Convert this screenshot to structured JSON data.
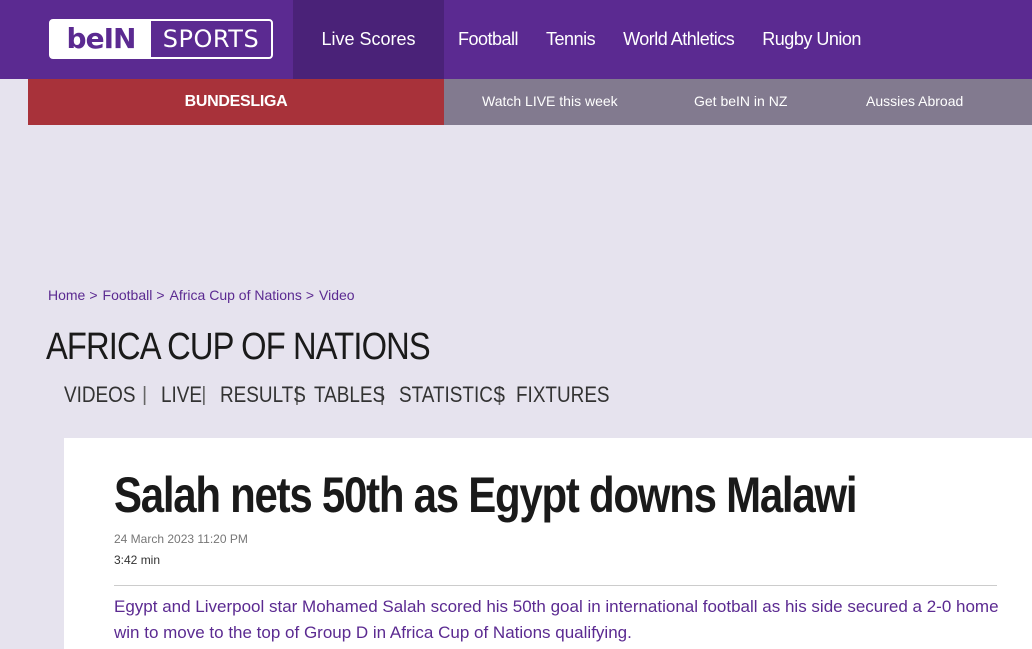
{
  "brand": {
    "logo_left": "beIN",
    "logo_right": "SPORTS"
  },
  "topnav": {
    "live_scores": "Live Scores",
    "items": [
      "Football",
      "Tennis",
      "World Athletics",
      "Rugby Union"
    ]
  },
  "subnav": {
    "featured": "BUNDESLIGA",
    "items": [
      "Watch LIVE this week",
      "Get beIN in NZ",
      "Aussies Abroad"
    ]
  },
  "breadcrumb": [
    "Home",
    "Football",
    "Africa Cup of Nations",
    "Video"
  ],
  "breadcrumb_sep": ">",
  "section": {
    "title": "AFRICA CUP OF NATIONS",
    "tabs": [
      "VIDEOS",
      "LIVE",
      "RESULTS",
      "TABLES",
      "STATISTICS",
      "FIXTURES"
    ],
    "tab_sep": "|"
  },
  "article": {
    "headline": "Salah nets 50th as Egypt downs Malawi",
    "date": "24 March 2023 11:20 PM",
    "duration": "3:42 min",
    "lede": "Egypt and Liverpool star Mohamed Salah scored his 50th goal in international football as his side secured a 2-0 home win to move to the top of Group D in Africa Cup of Nations qualifying."
  },
  "colors": {
    "brand_purple": "#5b2a91",
    "live_scores_bg": "#4a2278",
    "bundesliga_red": "#a8323a",
    "subnav_grey": "#827a8f",
    "page_bg": "#e6e3ee"
  }
}
